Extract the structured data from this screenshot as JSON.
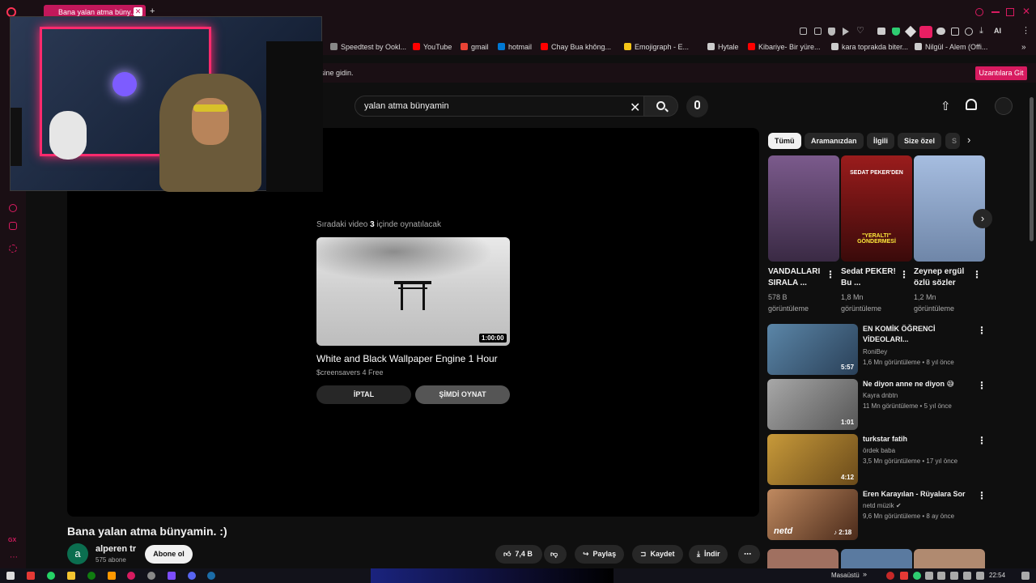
{
  "browser": {
    "tab_title": "Bana yalan atma büny...",
    "tab_close": "✕",
    "new_tab": "+",
    "ai_label": "AI",
    "bookmarks": [
      {
        "label": "Speedtest by Ookl...",
        "color": "#888888"
      },
      {
        "label": "YouTube",
        "color": "#ff0000"
      },
      {
        "label": "gmail",
        "color": "#ea4335"
      },
      {
        "label": "hotmail",
        "color": "#0078d4"
      },
      {
        "label": "Chay Bua không...",
        "color": "#ff0000"
      },
      {
        "label": "Emojigraph - E...",
        "color": "#f5c518"
      },
      {
        "label": "Hytale",
        "color": "#cccccc"
      },
      {
        "label": "Kibariye- Bir yüre...",
        "color": "#ff0000"
      },
      {
        "label": "kara toprakda biter...",
        "color": "#cccccc"
      },
      {
        "label": "Nilgül - Alem (Offi...",
        "color": "#cccccc"
      }
    ],
    "notice_text": "sine gidin.",
    "notice_button": "Uzantılara Git"
  },
  "youtube": {
    "search_value": "yalan atma bünyamin",
    "player": {
      "upnext_prefix": "Sıradaki video",
      "upnext_count": "3",
      "upnext_suffix": "içinde oynatılacak",
      "next_title": "White and Black Wallpaper Engine 1 Hour",
      "next_channel": "$creensavers 4 Free",
      "next_duration": "1:00:00",
      "cancel_label": "İPTAL",
      "play_label": "ŞİMDİ OYNAT"
    },
    "video": {
      "title": "Bana yalan atma bünyamin. :)",
      "avatar_letter": "a",
      "channel": "alperen tr",
      "subscribers": "575 abone",
      "subscribe_label": "Abone ol",
      "likes": "7,4 B",
      "share_label": "Paylaş",
      "save_label": "Kaydet",
      "download_label": "İndir"
    },
    "chips": [
      "Tümü",
      "Aramanızdan",
      "İlgili",
      "Size özel",
      "S"
    ],
    "shorts": [
      {
        "title": "VANDALLARI SIRALA ...",
        "views": "578 B görüntüleme",
        "color": "#6a4c7a"
      },
      {
        "title": "Sedat PEKER! Bu ...",
        "views": "1,8 Mn görüntüleme",
        "color": "#7a2020",
        "overlay_top": "SEDAT PEKER'DEN",
        "overlay_bottom": "\"YERALTI\" GÖNDERMESİ"
      },
      {
        "title": "Zeynep ergül özlü sözler",
        "views": "1,2 Mn görüntüleme",
        "color": "#8aa6c8"
      }
    ],
    "related": [
      {
        "title": "EN KOMİK ÖĞRENCİ VİDEOLARI...",
        "channel": "RoniBey",
        "meta": "1,6 Mn görüntüleme • 8 yıl önce",
        "duration": "5:57",
        "color": "#4a6b8a"
      },
      {
        "title": "Ne diyon anne ne diyon 😅",
        "channel": "Kayra dnbtn",
        "meta": "11 Mn görüntüleme • 5 yıl önce",
        "duration": "1:01",
        "color": "#8a8a8a"
      },
      {
        "title": "turkstar fatih",
        "channel": "ördek baba",
        "meta": "3,5 Mn görüntüleme • 17 yıl önce",
        "duration": "4:12",
        "color": "#a0722a"
      },
      {
        "title": "Eren Karayılan - Rüyalara Sor",
        "channel": "netd müzik",
        "meta": "9,6 Mn görüntüleme • 8 ay önce",
        "duration": "♪ 2:18",
        "color": "#7a5a40",
        "logo": "netd"
      }
    ]
  },
  "taskbar": {
    "folder_label": "Masaüstü",
    "clock": "22:54"
  }
}
